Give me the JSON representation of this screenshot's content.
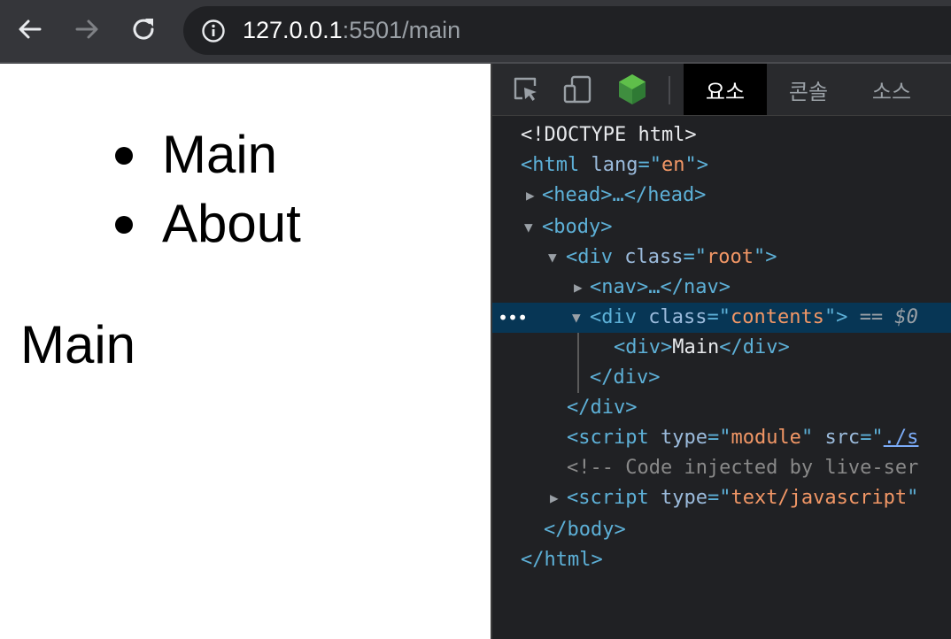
{
  "browser": {
    "url_host": "127.0.0.1",
    "url_path": ":5501/main"
  },
  "page": {
    "nav_items": [
      "Main",
      "About"
    ],
    "contents_text": "Main"
  },
  "devtools": {
    "tabs": [
      "요소",
      "콘솔",
      "소스"
    ],
    "active_tab": "요소",
    "dom": {
      "doctype": "<!DOCTYPE html>",
      "html_open_tag": "<html",
      "html_lang_attr": "lang",
      "html_lang_val": "en",
      "head": "<head>…</head>",
      "body_open": "<body>",
      "div_root_tag": "<div",
      "div_root_attr": "class",
      "div_root_val": "root",
      "nav": "<nav>…</nav>",
      "div_contents_tag": "<div",
      "div_contents_attr": "class",
      "div_contents_val": "contents",
      "selected_marker": "== $0",
      "inner_div_open": "<div>",
      "inner_div_text": "Main",
      "inner_div_close": "</div>",
      "div_contents_close": "</div>",
      "div_root_close": "</div>",
      "script1_tag": "<script",
      "script1_type_attr": "type",
      "script1_type_val": "module",
      "script1_src_attr": "src",
      "script1_src_val": "./s",
      "comment": "<!-- Code injected by live-ser",
      "script2_tag": "<script",
      "script2_type_attr": "type",
      "script2_type_val": "text/javascript",
      "body_close": "</body>",
      "html_close": "</html>"
    }
  },
  "colors": {
    "devtools_bg": "#202124",
    "selected_row": "#073655",
    "tag": "#5db0d7",
    "attr_value": "#f29766"
  }
}
